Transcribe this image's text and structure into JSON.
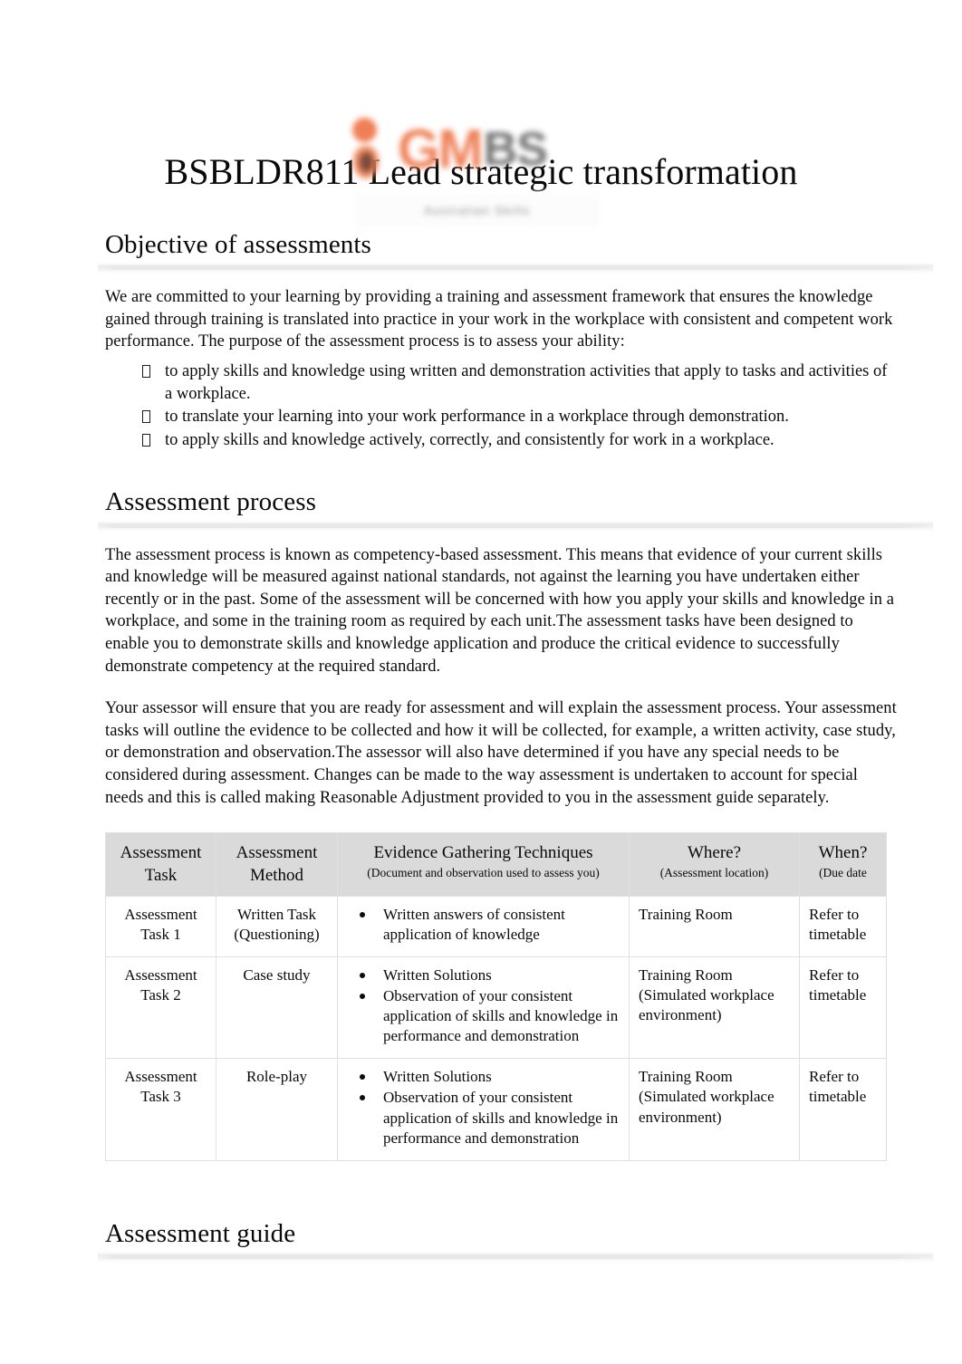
{
  "logo": {
    "mark_name": "gm-circles-logo-mark",
    "word_primary": "GM",
    "word_secondary": "BS",
    "subtitle": "Australian Skills",
    "color_primary": "#ef7b50",
    "color_secondary": "#6e6e6e"
  },
  "document": {
    "title": "BSBLDR811 Lead strategic transformation"
  },
  "sections": {
    "objective": {
      "heading": "Objective of assessments",
      "paragraph": "We are committed to your learning by providing a training and assessment framework that ensures the knowledge gained through training is translated into practice in your work in the workplace with consistent and competent work performance. The purpose of the assessment process is to assess your ability:",
      "bullets": [
        "to apply skills and knowledge using written and demonstration activities that apply to tasks and activities of a workplace.",
        "to translate your learning into your work performance in a workplace through demonstration.",
        "to apply skills and knowledge actively, correctly, and consistently for work in a workplace."
      ]
    },
    "process": {
      "heading": "Assessment process",
      "paragraph_1": "The assessment process is known as competency-based assessment. This means that evidence of your current skills and knowledge will be measured against national standards, not against the learning you have undertaken either recently or in the past. Some of the assessment will be concerned with how you apply your skills and knowledge in a workplace, and some in the training room as required by each unit.The assessment tasks have been designed to enable you to demonstrate skills and knowledge application and produce the critical evidence to successfully demonstrate competency at the required standard.",
      "paragraph_2": "Your assessor will ensure that you are ready for assessment and will explain the assessment process. Your assessment tasks will outline the evidence to be collected and how it will be collected, for example, a written activity, case study, or demonstration and observation.The assessor will also have determined if you have any special needs to be considered during assessment. Changes can be made to the way assessment is undertaken to account for special needs and this is called making Reasonable Adjustment provided to you in the assessment guide separately."
    },
    "guide": {
      "heading": "Assessment guide"
    }
  },
  "table": {
    "header_bg": "#dadada",
    "columns": [
      {
        "main": "Assessment Task",
        "sub": ""
      },
      {
        "main": "Assessment Method",
        "sub": ""
      },
      {
        "main": "Evidence Gathering Techniques",
        "sub": "(Document and observation used to assess you)"
      },
      {
        "main": "Where?",
        "sub": "(Assessment location)"
      },
      {
        "main": "When?",
        "sub": "(Due date"
      }
    ],
    "rows": [
      {
        "task": "Assessment Task 1",
        "method": "Written Task (Questioning)",
        "evidence": [
          "Written answers of consistent application of knowledge"
        ],
        "where": "Training Room",
        "when": "Refer to timetable"
      },
      {
        "task": "Assessment Task 2",
        "method": "Case study",
        "evidence": [
          "Written Solutions",
          "Observation of your consistent application of skills and knowledge in performance and demonstration"
        ],
        "where": "Training Room (Simulated workplace environment)",
        "when": "Refer to timetable"
      },
      {
        "task": "Assessment Task 3",
        "method": "Role-play",
        "evidence": [
          "Written Solutions",
          "Observation of your consistent application of skills and knowledge in performance and demonstration"
        ],
        "where": "Training Room (Simulated workplace environment)",
        "when": "Refer to timetable"
      }
    ]
  }
}
